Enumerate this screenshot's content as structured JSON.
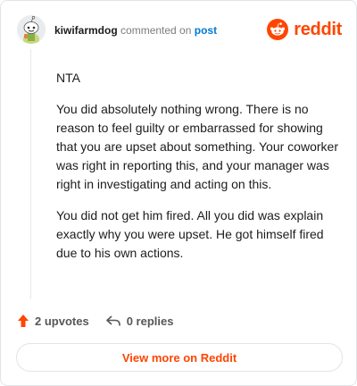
{
  "comment": {
    "author": "kiwifarmdog",
    "action_text": "commented on",
    "post_link_text": "post",
    "brand_name": "reddit",
    "paragraphs": [
      "NTA",
      "You did absolutely nothing wrong. There is no reason to feel guilty or embarrassed for showing that you are upset about something. Your coworker was right in reporting this, and your manager was right in investigating and acting on this.",
      "You did not get him fired. All you did was explain exactly why you were upset. He got himself fired due to his own actions."
    ],
    "upvotes_label": "2 upvotes",
    "replies_label": "0 replies",
    "view_more_label": "View more on Reddit"
  },
  "colors": {
    "brand": "#ff4500",
    "link": "#0079d3",
    "muted": "#7c7c7c"
  },
  "icons": {
    "avatar": "snoo-avatar-icon",
    "logo": "reddit-alien-icon",
    "upvote": "upvote-arrow-icon",
    "reply": "reply-arrow-icon"
  }
}
